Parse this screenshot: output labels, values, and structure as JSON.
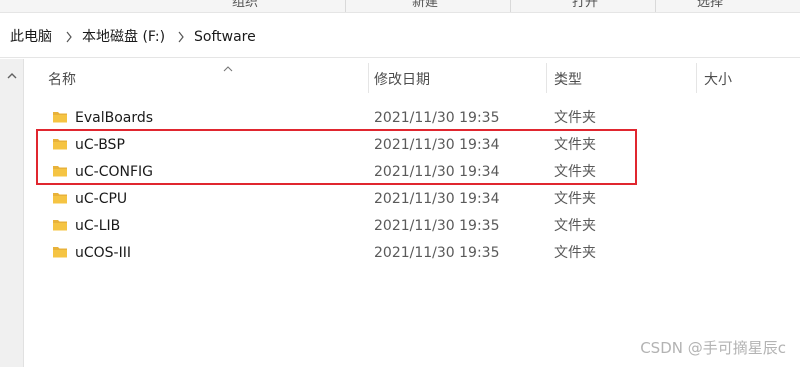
{
  "ribbon": {
    "groups": [
      "组织",
      "新建",
      "打开",
      "选择"
    ]
  },
  "breadcrumb": {
    "items": [
      "此电脑",
      "本地磁盘 (F:)",
      "Software"
    ]
  },
  "columns": {
    "name": "名称",
    "date": "修改日期",
    "type": "类型",
    "size": "大小"
  },
  "files": [
    {
      "name": "EvalBoards",
      "date": "2021/11/30 19:35",
      "type": "文件夹"
    },
    {
      "name": "uC-BSP",
      "date": "2021/11/30 19:34",
      "type": "文件夹"
    },
    {
      "name": "uC-CONFIG",
      "date": "2021/11/30 19:34",
      "type": "文件夹"
    },
    {
      "name": "uC-CPU",
      "date": "2021/11/30 19:34",
      "type": "文件夹"
    },
    {
      "name": "uC-LIB",
      "date": "2021/11/30 19:35",
      "type": "文件夹"
    },
    {
      "name": "uCOS-III",
      "date": "2021/11/30 19:35",
      "type": "文件夹"
    }
  ],
  "watermark": "CSDN @手可摘星辰c",
  "colors": {
    "highlight": "#e0262f",
    "folder": "#f5c443"
  },
  "icons": {
    "folder": "folder-icon",
    "chevron": "chevron-right-icon",
    "sort": "sort-ascending-icon"
  }
}
